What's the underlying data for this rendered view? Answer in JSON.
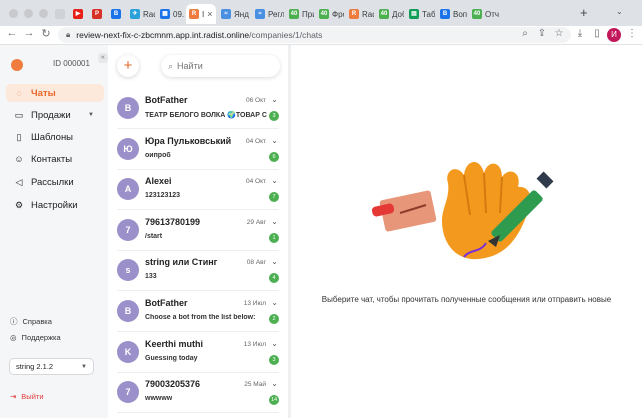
{
  "browser": {
    "tabs": [
      {
        "label": "",
        "fav_color": "#cfd2d6",
        "fav_text": ""
      },
      {
        "label": "",
        "fav_color": "#e62117",
        "fav_text": "▶"
      },
      {
        "label": "",
        "fav_color": "#d93025",
        "fav_text": "P"
      },
      {
        "label": "",
        "fav_color": "#1a73e8",
        "fav_text": "B"
      },
      {
        "label": "Radi",
        "fav_color": "#2aa1da",
        "fav_text": "✈"
      },
      {
        "label": "09.1",
        "fav_color": "#1a73e8",
        "fav_text": "▦"
      },
      {
        "label": "I",
        "fav_color": "#f07b3f",
        "fav_text": "R"
      },
      {
        "label": "Янд",
        "fav_color": "#4a90e2",
        "fav_text": "≈"
      },
      {
        "label": "Регл",
        "fav_color": "#4a90e2",
        "fav_text": "≈"
      },
      {
        "label": "При",
        "fav_color": "#4caf50",
        "fav_text": "40"
      },
      {
        "label": "Фро",
        "fav_color": "#4caf50",
        "fav_text": "40"
      },
      {
        "label": "Radi",
        "fav_color": "#f07b3f",
        "fav_text": "R"
      },
      {
        "label": "Доб",
        "fav_color": "#4caf50",
        "fav_text": "40"
      },
      {
        "label": "Табл",
        "fav_color": "#0f9d58",
        "fav_text": "▤"
      },
      {
        "label": "Вопр",
        "fav_color": "#1a73e8",
        "fav_text": "B"
      },
      {
        "label": "Отч",
        "fav_color": "#4caf50",
        "fav_text": "40"
      }
    ],
    "url_domain": "review-next-fix-c-zbcmnm.app.int.radist.online",
    "url_path": "/companies/1/chats",
    "profile_initial": "И"
  },
  "sidebar": {
    "company_id": "ID 000001",
    "items": [
      {
        "label": "Чаты",
        "icon": "chat-icon",
        "glyph": "◌"
      },
      {
        "label": "Продажи",
        "icon": "sales-icon",
        "glyph": "▭"
      },
      {
        "label": "Шаблоны",
        "icon": "templates-icon",
        "glyph": "▯"
      },
      {
        "label": "Контакты",
        "icon": "contacts-icon",
        "glyph": "☺"
      },
      {
        "label": "Рассылки",
        "icon": "broadcast-icon",
        "glyph": "◁"
      },
      {
        "label": "Настройки",
        "icon": "settings-icon",
        "glyph": "⚙"
      }
    ],
    "help_label": "Справка",
    "support_label": "Поддержка",
    "version": "string 2.1.2",
    "logout_label": "Выйти"
  },
  "chat_list": {
    "search_placeholder": "Найти",
    "chats": [
      {
        "initial": "B",
        "name": "BotFather",
        "date": "06 Окт",
        "preview": "ТЕАТР БЕЛОГО ВОЛКА 🌍ТОВАР САЛ",
        "unread": "3"
      },
      {
        "initial": "Ю",
        "name": "Юра Пульковський",
        "date": "04 Окт",
        "preview": "оипроб",
        "unread": "6"
      },
      {
        "initial": "A",
        "name": "Alexei",
        "date": "04 Окт",
        "preview": "123123123",
        "unread": "7"
      },
      {
        "initial": "7",
        "name": "79613780199",
        "date": "29 Авг",
        "preview": "/start",
        "unread": "1"
      },
      {
        "initial": "s",
        "name": "string или Стинг",
        "date": "08 Авг",
        "preview": "133",
        "unread": "4"
      },
      {
        "initial": "B",
        "name": "BotFather",
        "date": "13 Июл",
        "preview": "Choose a bot from the list below:",
        "unread": "2"
      },
      {
        "initial": "K",
        "name": "Keerthi muthi",
        "date": "13 Июл",
        "preview": "Guessing today",
        "unread": "3"
      },
      {
        "initial": "7",
        "name": "79003205376",
        "date": "25 Май",
        "preview": "wwwww",
        "unread": "14"
      }
    ]
  },
  "main": {
    "empty_message": "Выберите чат, чтобы прочитать полученные сообщения или отправить новые"
  },
  "colors": {
    "accent": "#e8672a",
    "avatar": "#9b90c9",
    "badge": "#4caf50"
  }
}
